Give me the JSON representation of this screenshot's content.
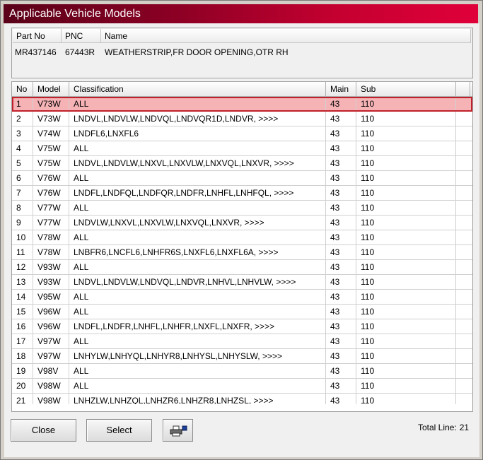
{
  "window": {
    "title": "Applicable Vehicle Models"
  },
  "part": {
    "headers": {
      "part_no": "Part No",
      "pnc": "PNC",
      "name": "Name"
    },
    "values": {
      "part_no": "MR437146",
      "pnc": "67443R",
      "name": "WEATHERSTRIP,FR DOOR OPENING,OTR RH"
    }
  },
  "table": {
    "headers": {
      "no": "No",
      "model": "Model",
      "classification": "Classification",
      "main": "Main",
      "sub": "Sub"
    },
    "selected_row": 0,
    "rows": [
      {
        "no": "1",
        "model": "V73W",
        "classification": "ALL",
        "main": "43",
        "sub": "110"
      },
      {
        "no": "2",
        "model": "V73W",
        "classification": "LNDVL,LNDVLW,LNDVQL,LNDVQR1D,LNDVR,  >>>>",
        "main": "43",
        "sub": "110"
      },
      {
        "no": "3",
        "model": "V74W",
        "classification": "LNDFL6,LNXFL6",
        "main": "43",
        "sub": "110"
      },
      {
        "no": "4",
        "model": "V75W",
        "classification": "ALL",
        "main": "43",
        "sub": "110"
      },
      {
        "no": "5",
        "model": "V75W",
        "classification": "LNDVL,LNDVLW,LNXVL,LNXVLW,LNXVQL,LNXVR,  >>>>",
        "main": "43",
        "sub": "110"
      },
      {
        "no": "6",
        "model": "V76W",
        "classification": "ALL",
        "main": "43",
        "sub": "110"
      },
      {
        "no": "7",
        "model": "V76W",
        "classification": "LNDFL,LNDFQL,LNDFQR,LNDFR,LNHFL,LNHFQL,  >>>>",
        "main": "43",
        "sub": "110"
      },
      {
        "no": "8",
        "model": "V77W",
        "classification": "ALL",
        "main": "43",
        "sub": "110"
      },
      {
        "no": "9",
        "model": "V77W",
        "classification": "LNDVLW,LNXVL,LNXVLW,LNXVQL,LNXVR,  >>>>",
        "main": "43",
        "sub": "110"
      },
      {
        "no": "10",
        "model": "V78W",
        "classification": "ALL",
        "main": "43",
        "sub": "110"
      },
      {
        "no": "11",
        "model": "V78W",
        "classification": "LNBFR6,LNCFL6,LNHFR6S,LNXFL6,LNXFL6A,  >>>>",
        "main": "43",
        "sub": "110"
      },
      {
        "no": "12",
        "model": "V93W",
        "classification": "ALL",
        "main": "43",
        "sub": "110"
      },
      {
        "no": "13",
        "model": "V93W",
        "classification": "LNDVL,LNDVLW,LNDVQL,LNDVR,LNHVL,LNHVLW,  >>>>",
        "main": "43",
        "sub": "110"
      },
      {
        "no": "14",
        "model": "V95W",
        "classification": "ALL",
        "main": "43",
        "sub": "110"
      },
      {
        "no": "15",
        "model": "V96W",
        "classification": "ALL",
        "main": "43",
        "sub": "110"
      },
      {
        "no": "16",
        "model": "V96W",
        "classification": "LNDFL,LNDFR,LNHFL,LNHFR,LNXFL,LNXFR,  >>>>",
        "main": "43",
        "sub": "110"
      },
      {
        "no": "17",
        "model": "V97W",
        "classification": "ALL",
        "main": "43",
        "sub": "110"
      },
      {
        "no": "18",
        "model": "V97W",
        "classification": "LNHYLW,LNHYQL,LNHYR8,LNHYSL,LNHYSLW,  >>>>",
        "main": "43",
        "sub": "110"
      },
      {
        "no": "19",
        "model": "V98V",
        "classification": "ALL",
        "main": "43",
        "sub": "110"
      },
      {
        "no": "20",
        "model": "V98W",
        "classification": "ALL",
        "main": "43",
        "sub": "110"
      },
      {
        "no": "21",
        "model": "V98W",
        "classification": "LNHZLW,LNHZQL,LNHZR6,LNHZR8,LNHZSL,  >>>>",
        "main": "43",
        "sub": "110"
      }
    ]
  },
  "footer": {
    "close_label": "Close",
    "select_label": "Select",
    "print_icon": "printer-icon",
    "total_label": "Total Line:",
    "total_value": "21"
  },
  "colors": {
    "title_dark": "#5a0018",
    "title_bright": "#e0003a",
    "selected_fill": "#f6b3b6",
    "selected_border": "#c0202a"
  }
}
